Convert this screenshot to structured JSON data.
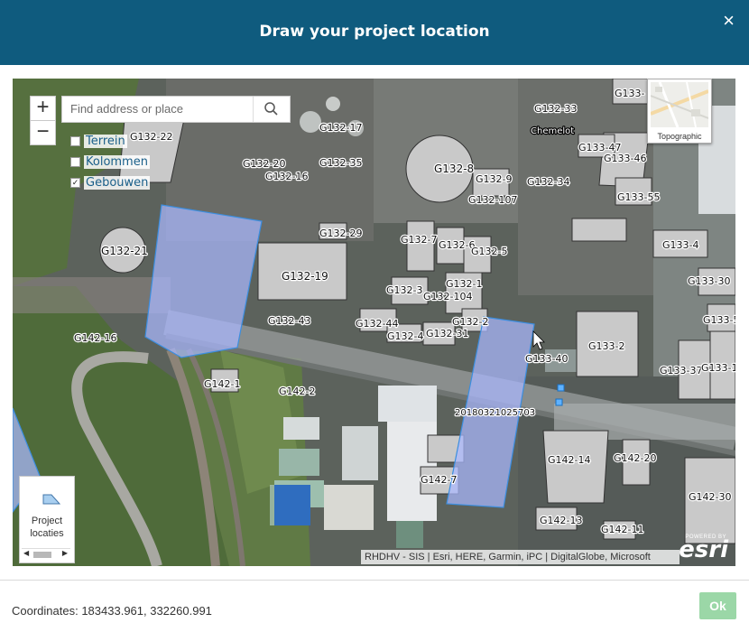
{
  "dialog": {
    "title": "Draw your project location",
    "close_glyph": "×"
  },
  "map": {
    "zoom_in": "+",
    "zoom_out": "−",
    "search": {
      "placeholder": "Find address or place",
      "icon": "search-icon"
    },
    "layers": [
      {
        "label": "Terrein",
        "checked": false
      },
      {
        "label": "Kolommen",
        "checked": false
      },
      {
        "label": "Gebouwen",
        "checked": true
      }
    ],
    "basemap_label": "Topographic",
    "tool": {
      "label_line1": "Project",
      "label_line2": "locaties",
      "icon": "polygon-icon"
    },
    "attribution": "RHDHV - SIS | Esri, HERE, Garmin, iPC | DigitalGlobe, Microsoft",
    "esri": {
      "powered_by": "POWERED BY",
      "logo": "esri"
    },
    "project_label": "20180321025703",
    "place_label": "Chemelot",
    "building_labels": [
      "G132-22",
      "G132-17",
      "G132-20",
      "G132-16",
      "G132-35",
      "G132-8",
      "G132-9",
      "G132-33",
      "G132-107",
      "G132-34",
      "G132-21",
      "G132-29",
      "G132-19",
      "G132-7",
      "G132-6",
      "G132-5",
      "G132-3",
      "G132-104",
      "G132-1",
      "G132-44",
      "G132-43",
      "G132-2",
      "G132-31",
      "G132-4",
      "G133-",
      "G133-47",
      "G133-46",
      "G133-55",
      "G133-4",
      "G133-30",
      "G133-5",
      "G133-2",
      "G133-37",
      "G133-1",
      "G133-40",
      "G142-16",
      "G142-1",
      "G142-2",
      "G142-14",
      "G142-20",
      "G142-7",
      "G142-30",
      "G142-13",
      "G142-11"
    ]
  },
  "footer": {
    "coordinates_text": "Coordinates: 183433.961, 332260.991",
    "ok_label": "Ok"
  },
  "colors": {
    "header": "#0f5b7e",
    "ok_button": "#9bd7a7",
    "layer_label": "#1a5f8a",
    "project_polygon": "#aab9ff"
  }
}
